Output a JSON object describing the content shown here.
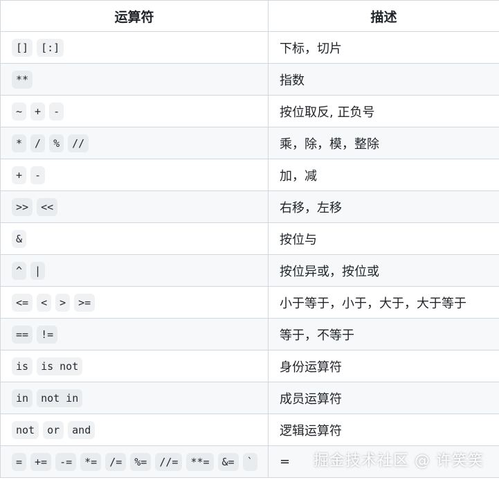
{
  "table": {
    "headers": [
      "运算符",
      "描述"
    ],
    "rows": [
      {
        "ops": [
          "[]",
          "[:]"
        ],
        "desc": "下标，切片"
      },
      {
        "ops": [
          "**"
        ],
        "desc": "指数"
      },
      {
        "ops": [
          "~",
          "+",
          "-"
        ],
        "desc": "按位取反, 正负号"
      },
      {
        "ops": [
          "*",
          "/",
          "%",
          "//"
        ],
        "desc": "乘，除，模，整除"
      },
      {
        "ops": [
          "+",
          "-"
        ],
        "desc": "加，减"
      },
      {
        "ops": [
          ">>",
          "<<"
        ],
        "desc": "右移，左移"
      },
      {
        "ops": [
          "&"
        ],
        "desc": "按位与"
      },
      {
        "ops": [
          "^",
          "|"
        ],
        "desc": "按位异或，按位或"
      },
      {
        "ops": [
          "<=",
          "<",
          ">",
          ">="
        ],
        "desc": "小于等于，小于，大于，大于等于"
      },
      {
        "ops": [
          "==",
          "!="
        ],
        "desc": "等于，不等于"
      },
      {
        "ops": [
          "is",
          "is not"
        ],
        "desc": "身份运算符"
      },
      {
        "ops": [
          "in",
          "not in"
        ],
        "desc": "成员运算符"
      },
      {
        "ops": [
          "not",
          "or",
          "and"
        ],
        "desc": "逻辑运算符"
      },
      {
        "ops": [
          "=",
          "+=",
          "-=",
          "*=",
          "/=",
          "%=",
          "//=",
          "**=",
          "&=",
          "`"
        ],
        "desc": "="
      }
    ]
  },
  "watermark": "掘金技术社区 @ 许笑笑"
}
